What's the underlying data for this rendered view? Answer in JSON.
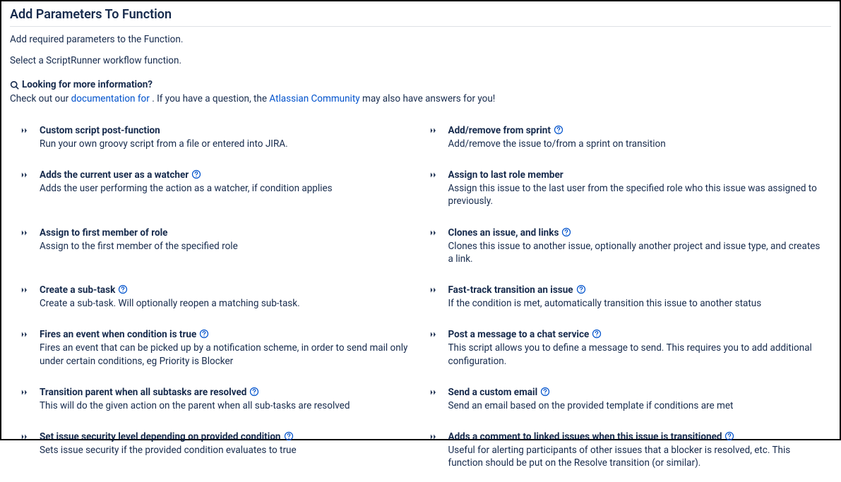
{
  "header": {
    "title": "Add Parameters To Function",
    "lead": "Add required parameters to the Function.",
    "subhead": "Select a ScriptRunner workflow function."
  },
  "info": {
    "heading": "Looking for more information?",
    "prefix": "Check out our ",
    "doc_link_text": "documentation for ",
    "middle": ". If you have a question, the ",
    "community_link_text": "Atlassian Community",
    "suffix": " may also have answers for you!"
  },
  "functions": [
    {
      "title": "Custom script post-function",
      "desc": "Run your own groovy script from a file or entered into JIRA.",
      "help": false
    },
    {
      "title": "Add/remove from sprint",
      "desc": "Add/remove the issue to/from a sprint on transition",
      "help": true
    },
    {
      "title": "Adds the current user as a watcher",
      "desc": "Adds the user performing the action as a watcher, if condition applies",
      "help": true
    },
    {
      "title": "Assign to last role member",
      "desc": "Assign this issue to the last user from the specified role who this issue was assigned to previously.",
      "help": false
    },
    {
      "title": "Assign to first member of role",
      "desc": "Assign to the first member of the specified role",
      "help": false
    },
    {
      "title": "Clones an issue, and links",
      "desc": "Clones this issue to another issue, optionally another project and issue type, and creates a link.",
      "help": true
    },
    {
      "title": "Create a sub-task",
      "desc": "Create a sub-task. Will optionally reopen a matching sub-task.",
      "help": true
    },
    {
      "title": "Fast-track transition an issue",
      "desc": "If the condition is met, automatically transition this issue to another status",
      "help": true
    },
    {
      "title": "Fires an event when condition is true",
      "desc": "Fires an event that can be picked up by a notification scheme, in order to send mail only under certain conditions, eg Priority is Blocker",
      "help": true
    },
    {
      "title": "Post a message to a chat service",
      "desc": "This script allows you to define a message to send. This requires you to add additional configuration.",
      "help": true
    },
    {
      "title": "Transition parent when all subtasks are resolved",
      "desc": "This will do the given action on the parent when all sub-tasks are resolved",
      "help": true
    },
    {
      "title": "Send a custom email",
      "desc": "Send an email based on the provided template if conditions are met",
      "help": true
    },
    {
      "title": "Set issue security level depending on provided condition",
      "desc": "Sets issue security if the provided condition evaluates to true",
      "help": true
    },
    {
      "title": "Adds a comment to linked issues when this issue is transitioned",
      "desc": "Useful for alerting participants of other issues that a blocker is resolved, etc. This function should be put on the Resolve transition (or similar).",
      "help": true
    }
  ]
}
